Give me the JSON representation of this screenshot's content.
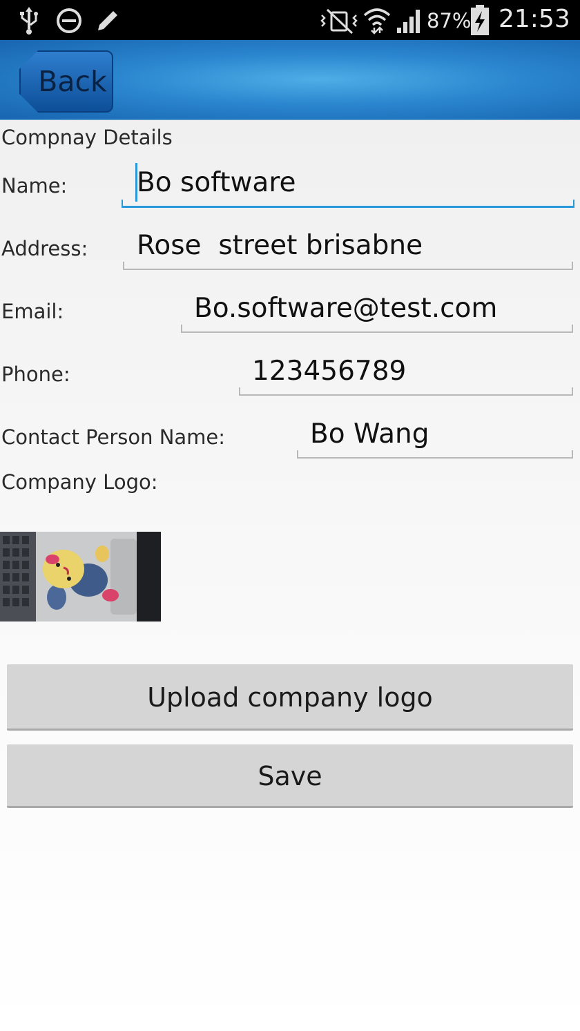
{
  "status_bar": {
    "battery": "87%",
    "time": "21:53",
    "icons": [
      "usb-icon",
      "do-not-disturb-icon",
      "pencil-icon",
      "vibrate-icon",
      "wifi-icon",
      "signal-icon",
      "battery-charging-icon"
    ]
  },
  "action_bar": {
    "back_label": "Back"
  },
  "form": {
    "section_title": "Compnay Details",
    "name_label": "Name:",
    "name_value": "Bo software",
    "address_label": "Address:",
    "address_value": "Rose  street brisabne",
    "email_label": "Email:",
    "email_value": "Bo.software@test.com",
    "phone_label": "Phone:",
    "phone_value": "123456789",
    "contact_label": "Contact Person Name:",
    "contact_value": "Bo Wang",
    "logo_label": "Company Logo:"
  },
  "buttons": {
    "upload_label": "Upload company logo",
    "save_label": "Save"
  },
  "colors": {
    "accent": "#2a98d8",
    "action_bar": "#2b86cf",
    "button_bg": "#d5d5d5"
  }
}
